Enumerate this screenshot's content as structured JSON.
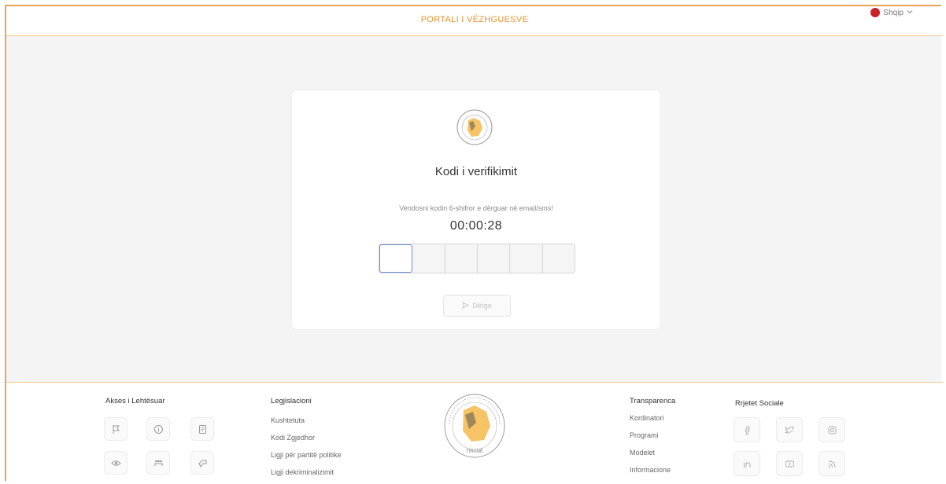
{
  "header": {
    "title": "PORTALI I VËZHGUESVE",
    "language": "Shqip"
  },
  "verification": {
    "title": "Kodi i verifikimit",
    "instruction": "Vendosni kodin 6-shifror e dërguar në email/sms!",
    "timer": "00:00:28",
    "code_digits": [
      "",
      "",
      "",
      "",
      "",
      ""
    ],
    "send_label": "Dërgo"
  },
  "seal": {
    "text_bottom": "TIRANË"
  },
  "footer": {
    "accessibility": {
      "title": "Akses i Lehtësuar",
      "icons": [
        "flag-icon",
        "info-icon",
        "document-icon",
        "eye-icon",
        "people-icon",
        "puzzle-icon"
      ]
    },
    "legislation": {
      "title": "Legjislacioni",
      "links": [
        "Kushtetuta",
        "Kodi Zgjedhor",
        "Ligji për partitë politike",
        "Ligji dekriminalizimit"
      ]
    },
    "transparency": {
      "title": "Transparenca",
      "links": [
        "Kordinatori",
        "Programi",
        "Modelet",
        "Informacione"
      ]
    },
    "social": {
      "title": "Rrjetet Sociale",
      "icons": [
        "facebook-icon",
        "twitter-icon",
        "instagram-icon",
        "linkedin-icon",
        "youtube-icon",
        "rss-icon"
      ]
    }
  },
  "colors": {
    "accent": "#e8952e",
    "header_border": "#f1c98e",
    "active_box": "#6b8fd6",
    "background": "#f4f4f5"
  }
}
